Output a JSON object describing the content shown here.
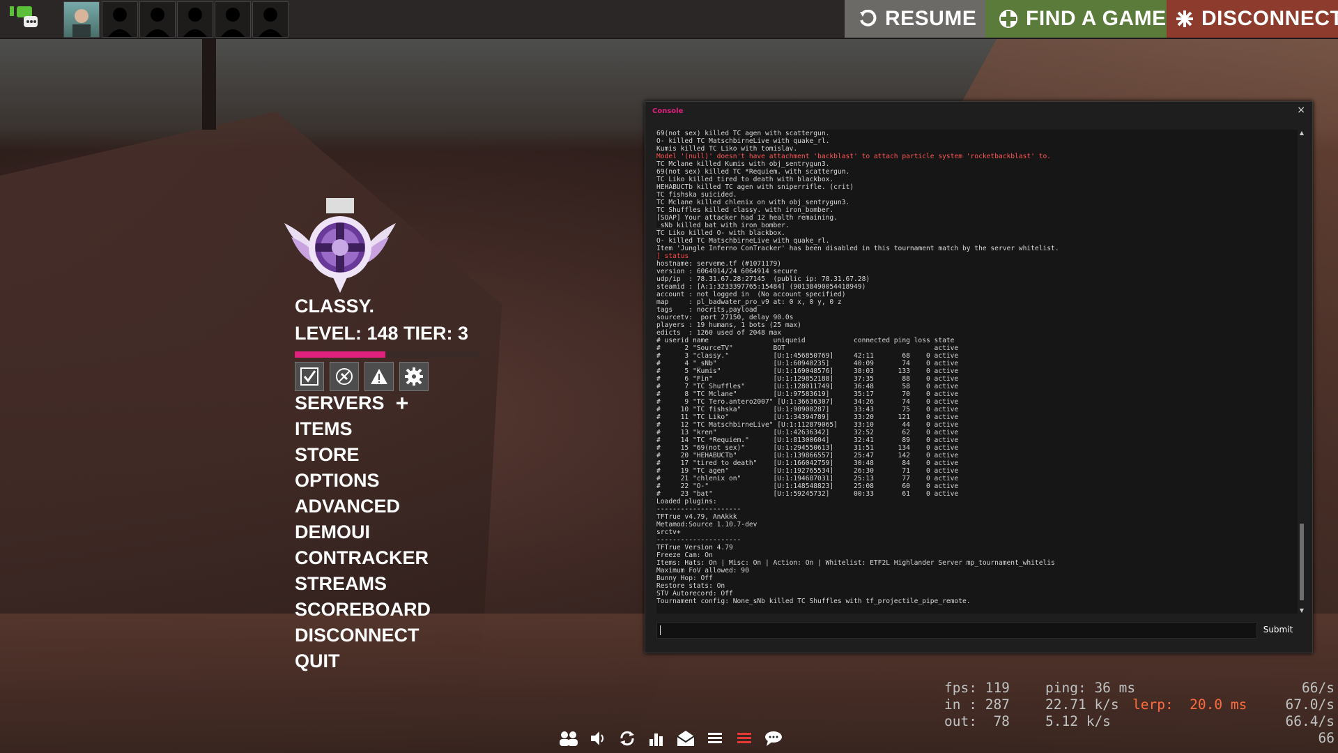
{
  "topbar": {
    "resume_label": "RESUME",
    "find_game_label": "FIND A GAME",
    "disconnect_label": "DISCONNECT"
  },
  "player": {
    "name": "CLASSY.",
    "level_text": "LEVEL: 148 TIER: 3",
    "xp_progress": 0.49
  },
  "menu": {
    "items": [
      "SERVERS",
      "ITEMS",
      "STORE",
      "OPTIONS",
      "ADVANCED",
      "DEMOUI",
      "CONTRACKER",
      "STREAMS",
      "SCOREBOARD",
      "DISCONNECT",
      "QUIT"
    ],
    "servers_plus": "+"
  },
  "console": {
    "title": "Console",
    "close": "×",
    "submit_label": "Submit",
    "lines": [
      {
        "t": "69(not sex) killed TC agen with scattergun."
      },
      {
        "t": "O- killed TC MatschbirneLive with quake_rl."
      },
      {
        "t": "Kumis killed TC Liko with tomislav."
      },
      {
        "t": "Model '(null)' doesn't have attachment 'backblast' to attach particle system 'rocketbackblast' to.",
        "c": "err"
      },
      {
        "t": "TC Mclane killed Kumis with obj_sentrygun3."
      },
      {
        "t": "69(not sex) killed TC *Requiem. with scattergun."
      },
      {
        "t": "TC Liko killed tired to death with blackbox."
      },
      {
        "t": "HEHABUCTb killed TC agen with sniperrifle. (crit)"
      },
      {
        "t": "TC fishska suicided."
      },
      {
        "t": "TC Mclane killed chlenix on with obj_sentrygun3."
      },
      {
        "t": "TC Shuffles killed classy. with iron_bomber."
      },
      {
        "t": "[SOAP] Your attacker had 12 health remaining."
      },
      {
        "t": "_sNb killed bat with iron_bomber."
      },
      {
        "t": "TC Liko killed O- with blackbox."
      },
      {
        "t": "O- killed TC MatschbirneLive with quake_rl."
      },
      {
        "t": "Item 'Jungle Inferno ConTracker' has been disabled in this tournament match by the server whitelist."
      },
      {
        "t": "] status",
        "c": "cmd"
      },
      {
        "t": "hostname: serveme.tf (#1071179)"
      },
      {
        "t": "version : 6064914/24 6064914 secure"
      },
      {
        "t": "udp/ip  : 78.31.67.28:27145  (public ip: 78.31.67.28)"
      },
      {
        "t": "steamid : [A:1:3233397765:15484] (90138490054418949)"
      },
      {
        "t": "account : not logged in  (No account specified)"
      },
      {
        "t": "map     : pl_badwater_pro_v9 at: 0 x, 0 y, 0 z"
      },
      {
        "t": "tags    : nocrits,payload"
      },
      {
        "t": "sourcetv:  port 27150, delay 90.0s"
      },
      {
        "t": "players : 19 humans, 1 bots (25 max)"
      },
      {
        "t": "edicts  : 1260 used of 2048 max"
      },
      {
        "t": "# userid name                uniqueid            connected ping loss state"
      },
      {
        "t": "#      2 \"SourceTV\"          BOT                                     active"
      },
      {
        "t": "#      3 \"classy.\"           [U:1:456850769]     42:11       68    0 active"
      },
      {
        "t": "#      4 \"_sNb\"              [U:1:60940235]      40:09       74    0 active"
      },
      {
        "t": "#      5 \"Kumis\"             [U:1:169048576]     38:03      133    0 active"
      },
      {
        "t": "#      6 \"Fin\"               [U:1:129852188]     37:35       88    0 active"
      },
      {
        "t": "#      7 \"TC Shuffles\"       [U:1:128011749]     36:48       58    0 active"
      },
      {
        "t": "#      8 \"TC Mclane\"         [U:1:97583619]      35:17       70    0 active"
      },
      {
        "t": "#      9 \"TC Tero.antero2007\" [U:1:36636307]     34:26       74    0 active"
      },
      {
        "t": "#     10 \"TC fishska\"        [U:1:90900287]      33:43       75    0 active"
      },
      {
        "t": "#     11 \"TC Liko\"           [U:1:34394789]      33:20      121    0 active"
      },
      {
        "t": "#     12 \"TC MatschbirneLive\" [U:1:112879065]    33:10       44    0 active"
      },
      {
        "t": "#     13 \"kren\"              [U:1:42636342]      32:52       62    0 active"
      },
      {
        "t": "#     14 \"TC *Requiem.\"      [U:1:81300604]      32:41       89    0 active"
      },
      {
        "t": "#     15 \"69(not sex)\"       [U:1:294550613]     31:51      134    0 active"
      },
      {
        "t": "#     20 \"HEHABUCTb\"         [U:1:139866557]     25:47      142    0 active"
      },
      {
        "t": "#     17 \"tired to death\"    [U:1:166042759]     30:48       84    0 active"
      },
      {
        "t": "#     19 \"TC agen\"           [U:1:192765534]     26:30       71    0 active"
      },
      {
        "t": "#     21 \"chlenix on\"        [U:1:194687031]     25:13       77    0 active"
      },
      {
        "t": "#     22 \"O-\"                [U:1:148548823]     25:08       60    0 active"
      },
      {
        "t": "#     23 \"bat\"               [U:1:59245732]      00:33       61    0 active"
      },
      {
        "t": "Loaded plugins:"
      },
      {
        "t": "---------------------"
      },
      {
        "t": "TFTrue v4.79, AnAkkk"
      },
      {
        "t": "Metamod:Source 1.10.7-dev"
      },
      {
        "t": "srctv+"
      },
      {
        "t": "---------------------"
      },
      {
        "t": "TFTrue Version 4.79"
      },
      {
        "t": "Freeze Cam: On"
      },
      {
        "t": "Items: Hats: On | Misc: On | Action: On | Whitelist: ETF2L Highlander Server mp_tournament_whitelis"
      },
      {
        "t": "Maximum FoV allowed: 90"
      },
      {
        "t": "Bunny Hop: Off"
      },
      {
        "t": "Restore stats: On"
      },
      {
        "t": "STV Autorecord: Off"
      },
      {
        "t": "Tournament config: None_sNb killed TC Shuffles with tf_projectile_pipe_remote."
      }
    ]
  },
  "netgraph": {
    "fps": "fps: 119",
    "ping": "ping: 36 ms",
    "in": "in : 287",
    "in_rate": "22.71 k/s",
    "lerp": "lerp:  20.0 ms",
    "out": "out:  78",
    "out_rate": "5.12 k/s",
    "right": [
      "66/s",
      "67.0/s",
      "66.4/s",
      "66"
    ]
  },
  "colors": {
    "accent": "#e0217e",
    "resume_bg": "#6b6a66",
    "find_bg": "#5b7b3a",
    "disconnect_bg": "#8c3b2d"
  }
}
